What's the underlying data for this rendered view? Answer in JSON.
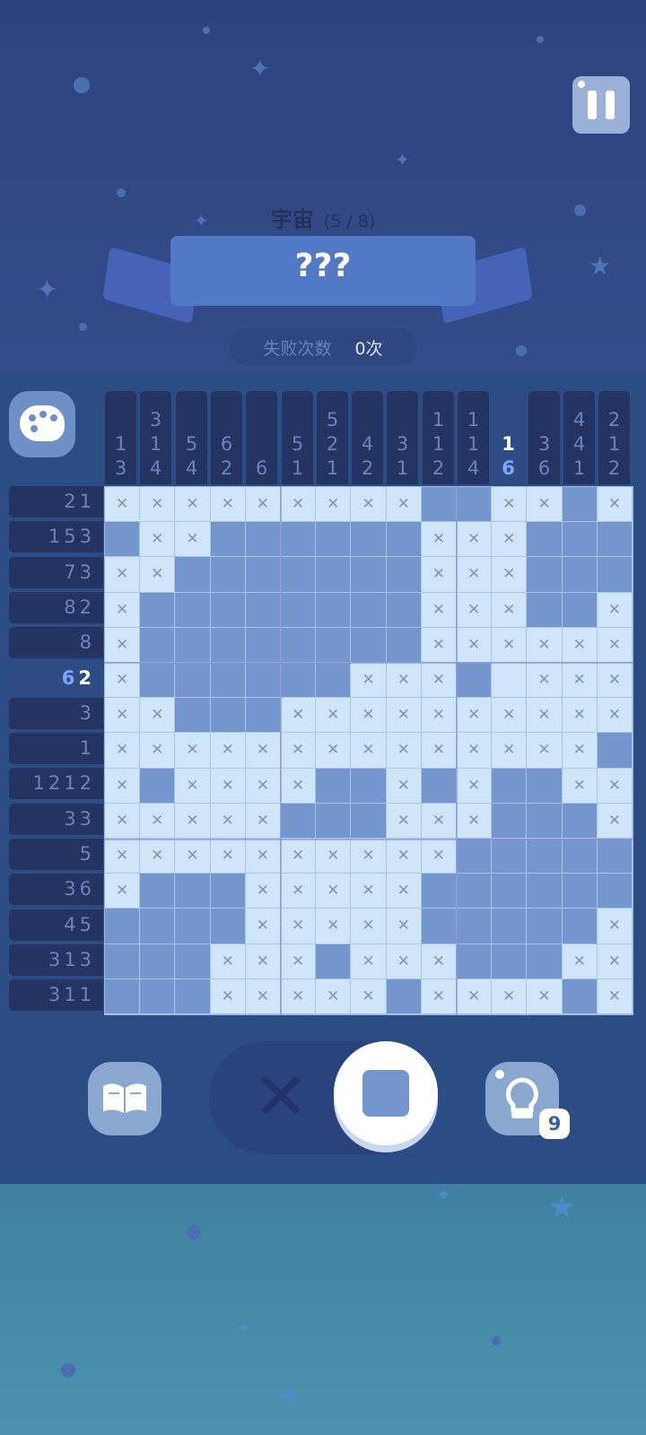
{
  "header": {
    "category": "宇宙",
    "progress": "(5 / 8)",
    "puzzle_name": "???",
    "fail_label": "失败次数",
    "fail_count": "0次"
  },
  "controls": {
    "hint_count": "9",
    "mode_selected": "fill"
  },
  "icons": {
    "pause": "pause-icon",
    "palette": "palette-icon",
    "book": "book-icon",
    "hint": "lightbulb-icon",
    "cross": "cross-icon",
    "fill_square": "square-icon"
  },
  "colors": {
    "filled": "#7595ce",
    "empty": "#cfe6fa",
    "clue_bg": "#243462",
    "clue_text": "#6a83be"
  },
  "puzzle": {
    "col_clues": [
      [
        "1",
        "3"
      ],
      [
        "3",
        "1",
        "4"
      ],
      [
        "5",
        "4"
      ],
      [
        "6",
        "2"
      ],
      [
        "6"
      ],
      [
        "5",
        "1"
      ],
      [
        "5",
        "2",
        "1"
      ],
      [
        "4",
        "2"
      ],
      [
        "3",
        "1"
      ],
      [
        "1",
        "1",
        "2"
      ],
      [
        "1",
        "1",
        "4"
      ],
      [
        "1",
        "6"
      ],
      [
        "3",
        "6"
      ],
      [
        "4",
        "4",
        "1"
      ],
      [
        "2",
        "1",
        "2"
      ]
    ],
    "row_clues": [
      [
        "2",
        "1"
      ],
      [
        "1",
        "5",
        "3"
      ],
      [
        "7",
        "3"
      ],
      [
        "8",
        "2"
      ],
      [
        "8"
      ],
      [
        "6",
        "2"
      ],
      [
        "3"
      ],
      [
        "1"
      ],
      [
        "1",
        "2",
        "1",
        "2"
      ],
      [
        "3",
        "3"
      ],
      [
        "5"
      ],
      [
        "3",
        "6"
      ],
      [
        "4",
        "5"
      ],
      [
        "3",
        "1",
        "3"
      ],
      [
        "3",
        "1",
        "1"
      ]
    ],
    "active_col": 11,
    "active_row": 5,
    "grid": [
      "xxxxxxxxxffxxfx",
      "fxxffffffxxxfff",
      "xxfffffffxxxfff",
      "xffffffffxxxffx",
      "xffffffffxxxxxx",
      "xffffffxxxfexxx",
      "xxfffxxxxxxxxxx",
      "xxxxxxxxxxxxxxf",
      "xfxxxxffxfxffxx",
      "xxxxxfffxxxfffx",
      "xxxxxxxxxxfffff",
      "xfffxxxxxffffff",
      "ffffxxxxxfffffx",
      "fffxxxfxxxfffxx",
      "fffxxxxxfxxxxfx"
    ]
  }
}
